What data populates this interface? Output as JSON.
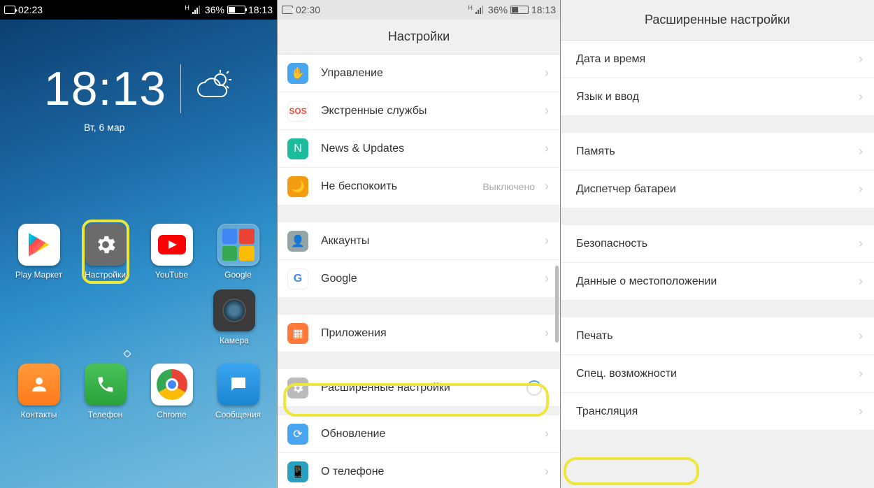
{
  "status": {
    "rec_time_1": "02:23",
    "rec_time_2": "02:30",
    "signal_pct": "36%",
    "time": "18:13"
  },
  "home": {
    "clock": "18:13",
    "date": "Вт, 6 мар",
    "search_brand": "Google",
    "apps_row": [
      {
        "label": "Play Маркет"
      },
      {
        "label": "Настройки"
      },
      {
        "label": "YouTube"
      },
      {
        "label": "Google"
      }
    ],
    "camera_label": "Камера",
    "dock": [
      {
        "label": "Контакты"
      },
      {
        "label": "Телефон"
      },
      {
        "label": "Chrome"
      },
      {
        "label": "Сообщения"
      }
    ]
  },
  "settings": {
    "title": "Настройки",
    "items": [
      {
        "label": "Управление"
      },
      {
        "label": "Экстренные службы"
      },
      {
        "label": "News & Updates"
      },
      {
        "label": "Не беспокоить",
        "sub": "Выключено"
      }
    ],
    "items2": [
      {
        "label": "Аккаунты"
      },
      {
        "label": "Google"
      }
    ],
    "items3": [
      {
        "label": "Приложения"
      }
    ],
    "items4": [
      {
        "label": "Расширенные настройки"
      }
    ],
    "items5": [
      {
        "label": "Обновление"
      },
      {
        "label": "О телефоне"
      }
    ]
  },
  "advanced": {
    "title": "Расширенные настройки",
    "g1": [
      {
        "label": "Дата и время"
      },
      {
        "label": "Язык и ввод"
      }
    ],
    "g2": [
      {
        "label": "Память"
      },
      {
        "label": "Диспетчер батареи"
      }
    ],
    "g3": [
      {
        "label": "Безопасность"
      },
      {
        "label": "Данные о местоположении"
      }
    ],
    "g4": [
      {
        "label": "Печать"
      },
      {
        "label": "Спец. возможности"
      },
      {
        "label": "Трансляция"
      }
    ]
  }
}
